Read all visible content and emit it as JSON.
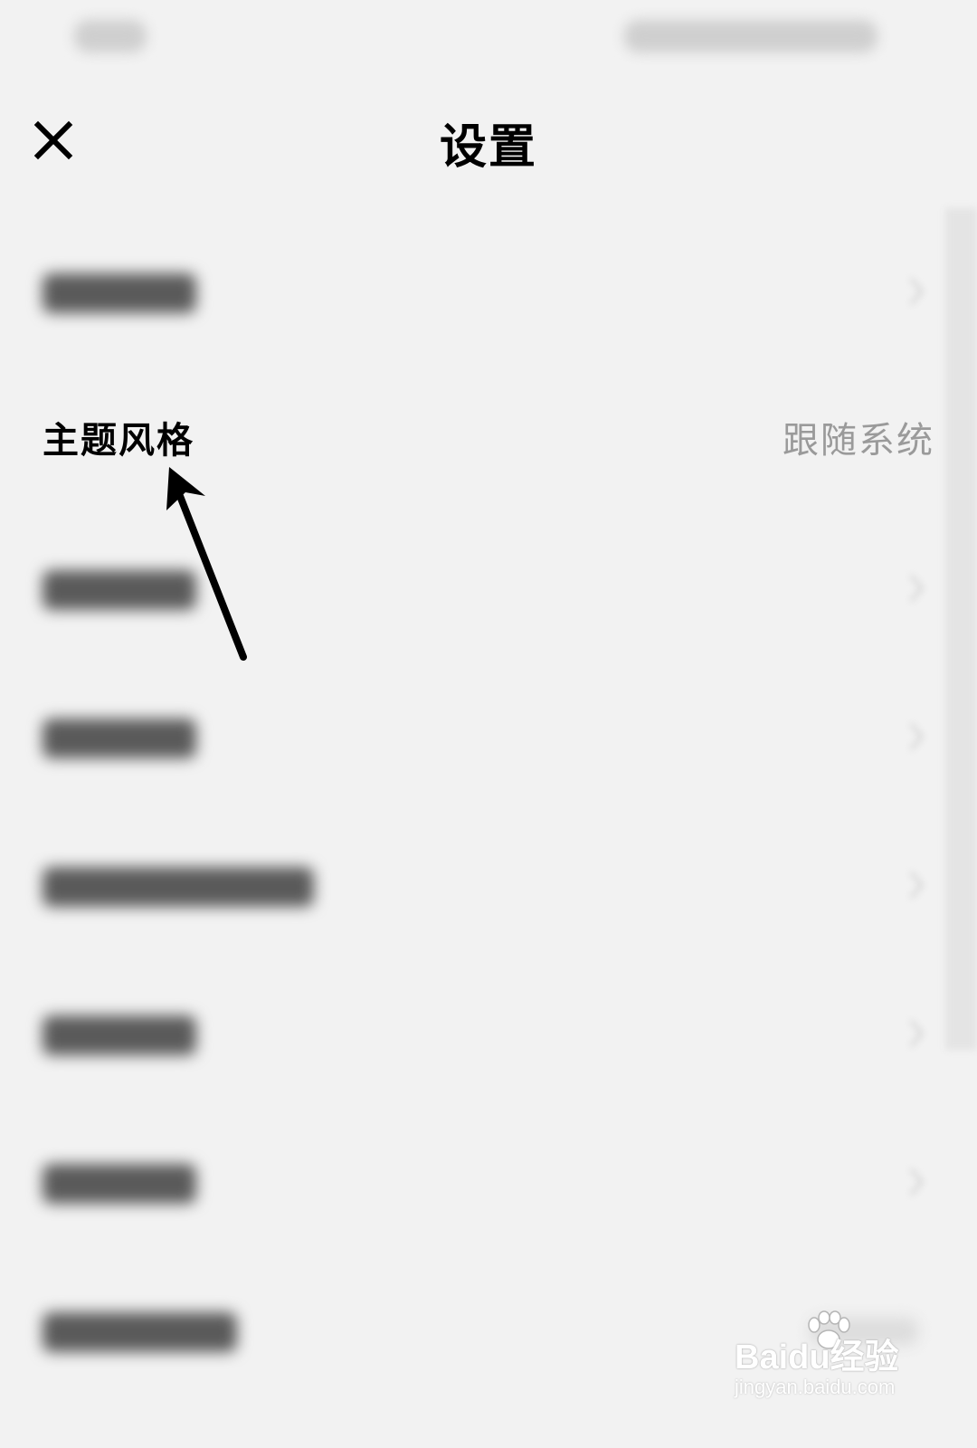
{
  "header": {
    "title": "设置",
    "close_icon": "close-icon"
  },
  "settings": {
    "items": [
      {
        "label": "",
        "value": "",
        "blurred": true
      },
      {
        "label": "主题风格",
        "value": "跟随系统",
        "blurred": false
      },
      {
        "label": "",
        "value": "",
        "blurred": true
      },
      {
        "label": "",
        "value": "",
        "blurred": true
      },
      {
        "label": "",
        "value": "",
        "blurred": true
      },
      {
        "label": "",
        "value": "",
        "blurred": true
      },
      {
        "label": "",
        "value": "",
        "blurred": true
      },
      {
        "label": "",
        "value": "",
        "blurred": true
      }
    ]
  },
  "annotation": {
    "icon": "arrow-icon",
    "color": "#000000"
  },
  "watermark": {
    "logo": "Baidu经验",
    "url": "jingyan.baidu.com"
  }
}
